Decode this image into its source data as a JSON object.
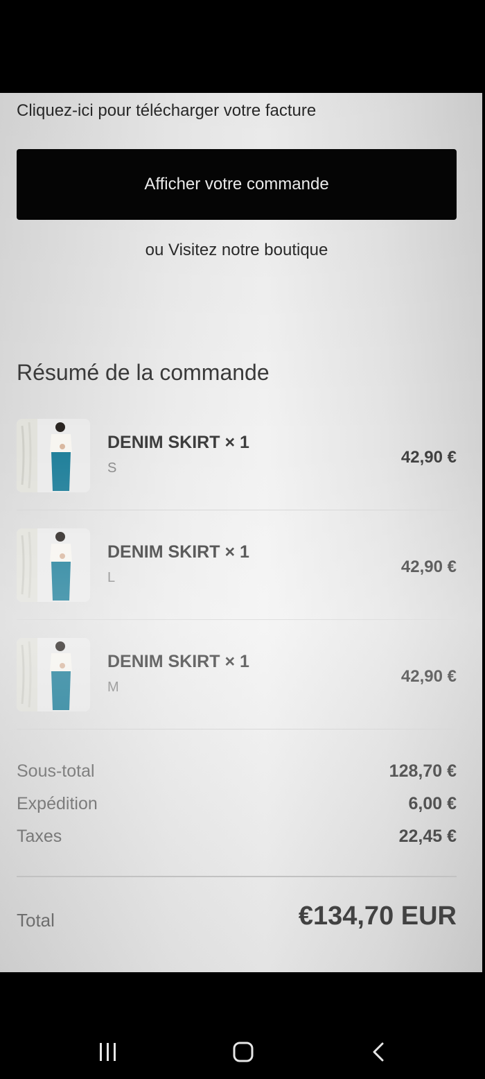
{
  "order": {
    "invoice_link": "Cliquez-ici pour télécharger votre facture",
    "view_order_label": "Afficher votre commande",
    "visit_shop_label": "ou Visitez notre boutique"
  },
  "summary": {
    "title": "Résumé de la commande",
    "items": [
      {
        "name": "DENIM SKIRT × 1",
        "variant": "S",
        "price": "42,90 €"
      },
      {
        "name": "DENIM SKIRT × 1",
        "variant": "L",
        "price": "42,90 €"
      },
      {
        "name": "DENIM SKIRT × 1",
        "variant": "M",
        "price": "42,90 €"
      }
    ]
  },
  "costs": {
    "subtotal_label": "Sous-total",
    "subtotal_value": "128,70 €",
    "shipping_label": "Expédition",
    "shipping_value": "6,00 €",
    "taxes_label": "Taxes",
    "taxes_value": "22,45 €",
    "total_label": "Total",
    "total_value": "€134,70 EUR"
  },
  "nav": {
    "icons": [
      "recent-apps-icon",
      "home-icon",
      "back-icon"
    ]
  },
  "colors": {
    "button_bg": "#050505",
    "button_text": "#f2f2f2",
    "skirt": "#1f7f9a"
  }
}
